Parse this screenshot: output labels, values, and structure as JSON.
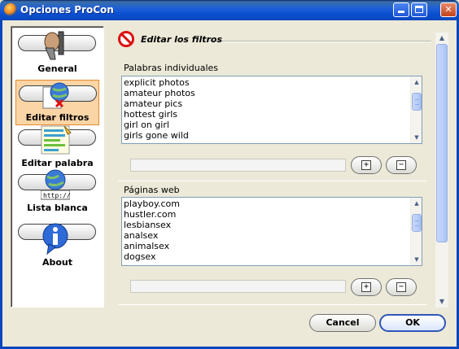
{
  "window": {
    "title": "Opciones ProCon"
  },
  "sidebar": {
    "items": [
      {
        "label": "General",
        "icon": "tools-icon",
        "selected": false
      },
      {
        "label": "Editar filtros",
        "icon": "globe-cross-icon",
        "selected": true
      },
      {
        "label": "Editar palabra",
        "icon": "word-list-icon",
        "selected": false
      },
      {
        "label": "Lista blanca",
        "icon": "globe-http-icon",
        "selected": false
      },
      {
        "label": "About",
        "icon": "info-icon",
        "selected": false
      }
    ]
  },
  "section": {
    "title": "Editar los filtros"
  },
  "words_group": {
    "label": "Palabras individuales",
    "items": [
      "explicit photos",
      "amateur photos",
      "amateur pics",
      "hottest girls",
      "girl on girl",
      "girls gone wild"
    ],
    "input_value": ""
  },
  "web_group": {
    "label": "Páginas web",
    "items": [
      "playboy.com",
      "hustler.com",
      "lesbiansex",
      "analsex",
      "animalsex",
      "dogsex"
    ],
    "input_value": ""
  },
  "buttons": {
    "add": "+",
    "remove": "−",
    "cancel": "Cancel",
    "ok": "OK"
  }
}
